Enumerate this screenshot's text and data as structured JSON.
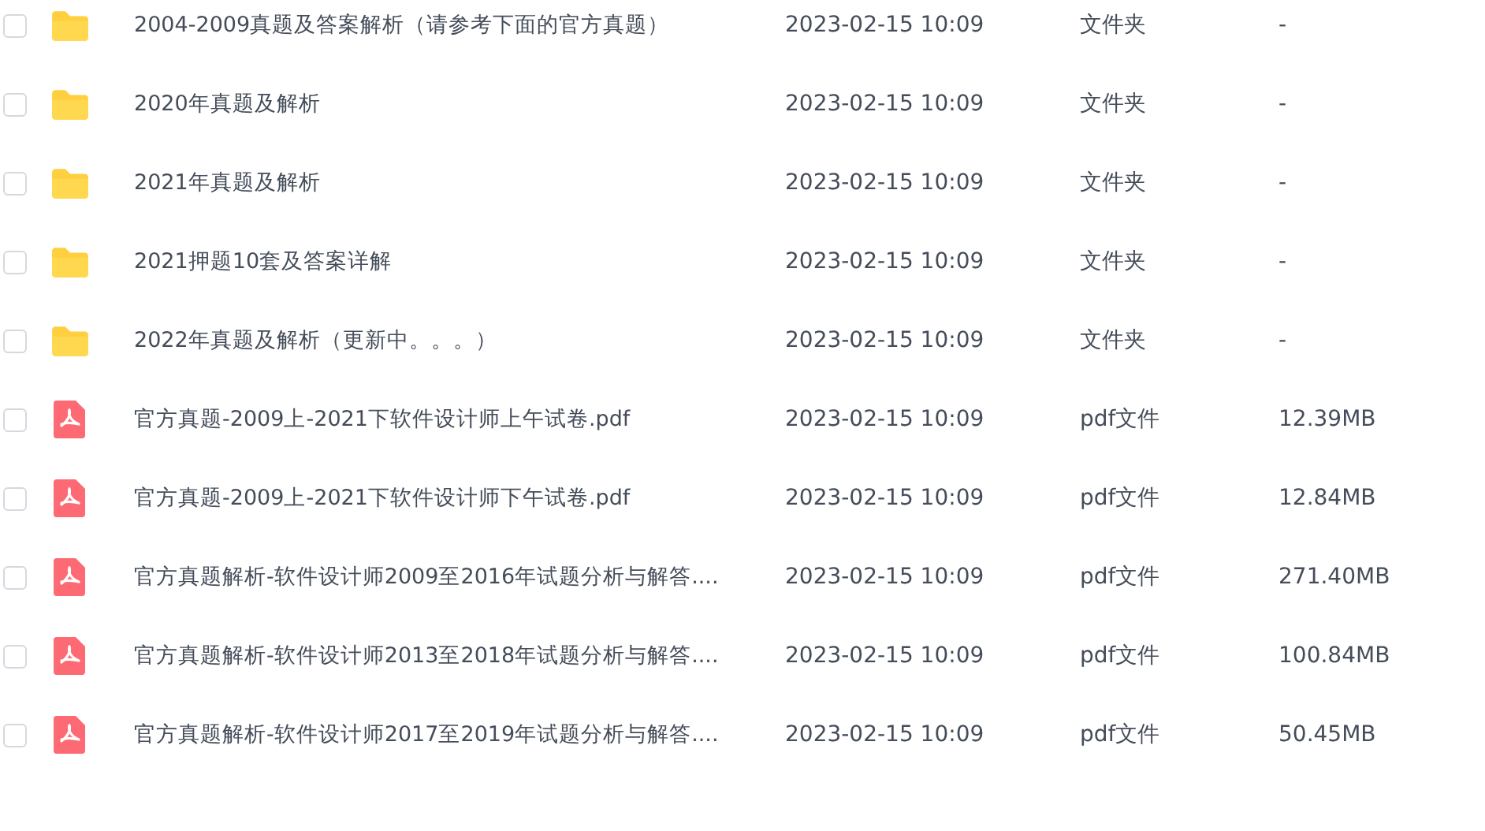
{
  "files": [
    {
      "kind": "folder",
      "checked": false,
      "name": "2004-2009真题及答案解析（请参考下面的官方真题）",
      "modified": "2023-02-15 10:09",
      "type": "文件夹",
      "size": "-"
    },
    {
      "kind": "folder",
      "checked": false,
      "name": "2020年真题及解析",
      "modified": "2023-02-15 10:09",
      "type": "文件夹",
      "size": "-"
    },
    {
      "kind": "folder",
      "checked": false,
      "name": "2021年真题及解析",
      "modified": "2023-02-15 10:09",
      "type": "文件夹",
      "size": "-"
    },
    {
      "kind": "folder",
      "checked": false,
      "name": "2021押题10套及答案详解",
      "modified": "2023-02-15 10:09",
      "type": "文件夹",
      "size": "-"
    },
    {
      "kind": "folder",
      "checked": false,
      "name": "2022年真题及解析（更新中。。。）",
      "modified": "2023-02-15 10:09",
      "type": "文件夹",
      "size": "-"
    },
    {
      "kind": "pdf",
      "checked": false,
      "name": "官方真题-2009上-2021下软件设计师上午试卷.pdf",
      "modified": "2023-02-15 10:09",
      "type": "pdf文件",
      "size": "12.39MB"
    },
    {
      "kind": "pdf",
      "checked": false,
      "name": "官方真题-2009上-2021下软件设计师下午试卷.pdf",
      "modified": "2023-02-15 10:09",
      "type": "pdf文件",
      "size": "12.84MB"
    },
    {
      "kind": "pdf",
      "checked": false,
      "name": "官方真题解析-软件设计师2009至2016年试题分析与解答....",
      "modified": "2023-02-15 10:09",
      "type": "pdf文件",
      "size": "271.40MB"
    },
    {
      "kind": "pdf",
      "checked": false,
      "name": "官方真题解析-软件设计师2013至2018年试题分析与解答....",
      "modified": "2023-02-15 10:09",
      "type": "pdf文件",
      "size": "100.84MB"
    },
    {
      "kind": "pdf",
      "checked": false,
      "name": "官方真题解析-软件设计师2017至2019年试题分析与解答....",
      "modified": "2023-02-15 10:09",
      "type": "pdf文件",
      "size": "50.45MB"
    }
  ]
}
